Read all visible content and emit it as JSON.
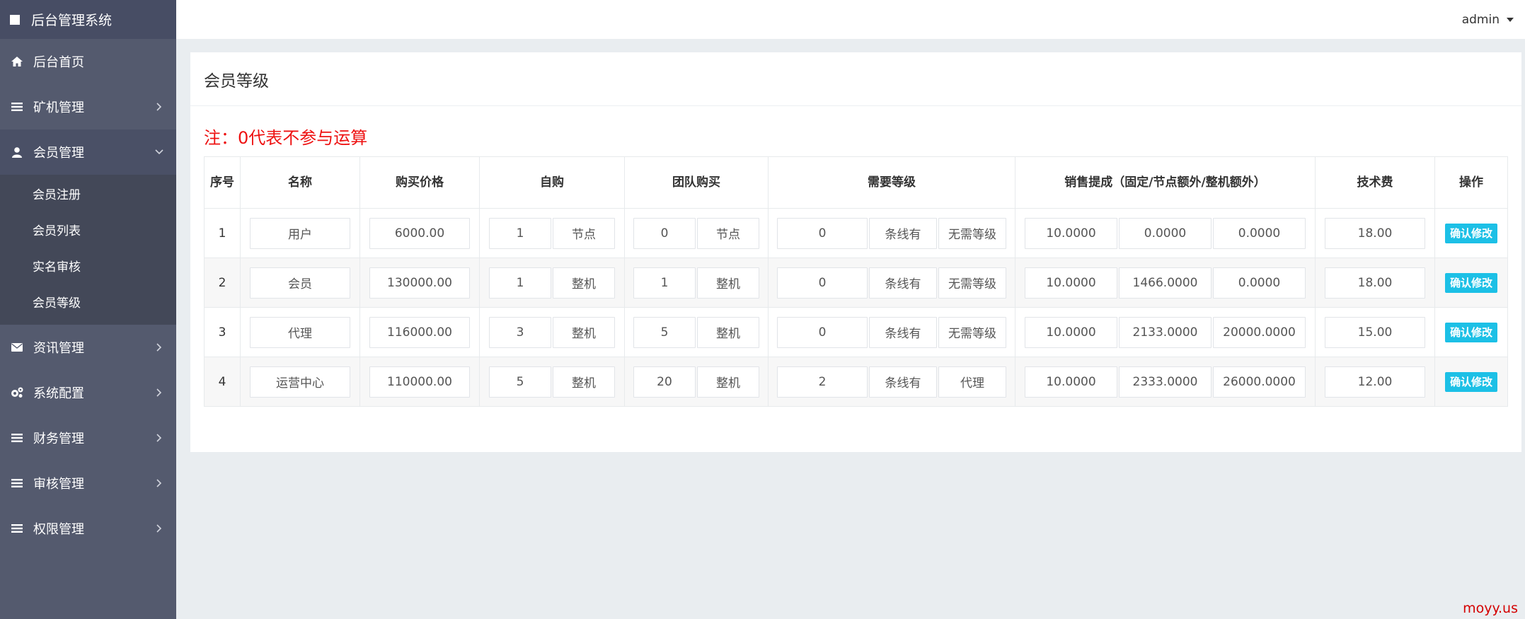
{
  "app": {
    "title": "后台管理系统"
  },
  "topbar": {
    "user": "admin"
  },
  "sidebar": {
    "items": [
      {
        "label": "后台首页",
        "icon": "home-icon"
      },
      {
        "label": "矿机管理",
        "icon": "list-icon"
      },
      {
        "label": "会员管理",
        "icon": "user-icon"
      },
      {
        "label": "资讯管理",
        "icon": "envelope-icon"
      },
      {
        "label": "系统配置",
        "icon": "cogs-icon"
      },
      {
        "label": "财务管理",
        "icon": "list-icon"
      },
      {
        "label": "审核管理",
        "icon": "list-icon"
      },
      {
        "label": "权限管理",
        "icon": "list-icon"
      }
    ],
    "submenu": [
      "会员注册",
      "会员列表",
      "实名审核",
      "会员等级"
    ]
  },
  "panel": {
    "title": "会员等级",
    "note": "注：0代表不参与运算"
  },
  "table": {
    "headers": [
      "序号",
      "名称",
      "购买价格",
      "自购",
      "团队购买",
      "需要等级",
      "销售提成（固定/节点额外/整机额外）",
      "技术费",
      "操作"
    ],
    "rows": [
      {
        "idx": "1",
        "name": "用户",
        "price": "6000.00",
        "self_qty": "1",
        "self_unit": "节点",
        "team_qty": "0",
        "team_unit": "节点",
        "need_count": "0",
        "need_mid": "条线有",
        "need_level": "无需等级",
        "sale_fixed": "10.0000",
        "sale_node": "0.0000",
        "sale_machine": "0.0000",
        "fee": "18.00",
        "action": "确认修改"
      },
      {
        "idx": "2",
        "name": "会员",
        "price": "130000.00",
        "self_qty": "1",
        "self_unit": "整机",
        "team_qty": "1",
        "team_unit": "整机",
        "need_count": "0",
        "need_mid": "条线有",
        "need_level": "无需等级",
        "sale_fixed": "10.0000",
        "sale_node": "1466.0000",
        "sale_machine": "0.0000",
        "fee": "18.00",
        "action": "确认修改"
      },
      {
        "idx": "3",
        "name": "代理",
        "price": "116000.00",
        "self_qty": "3",
        "self_unit": "整机",
        "team_qty": "5",
        "team_unit": "整机",
        "need_count": "0",
        "need_mid": "条线有",
        "need_level": "无需等级",
        "sale_fixed": "10.0000",
        "sale_node": "2133.0000",
        "sale_machine": "20000.0000",
        "fee": "15.00",
        "action": "确认修改"
      },
      {
        "idx": "4",
        "name": "运营中心",
        "price": "110000.00",
        "self_qty": "5",
        "self_unit": "整机",
        "team_qty": "20",
        "team_unit": "整机",
        "need_count": "2",
        "need_mid": "条线有",
        "need_level": "代理",
        "sale_fixed": "10.0000",
        "sale_node": "2333.0000",
        "sale_machine": "26000.0000",
        "fee": "12.00",
        "action": "确认修改"
      }
    ]
  },
  "watermark": "moyy.us"
}
